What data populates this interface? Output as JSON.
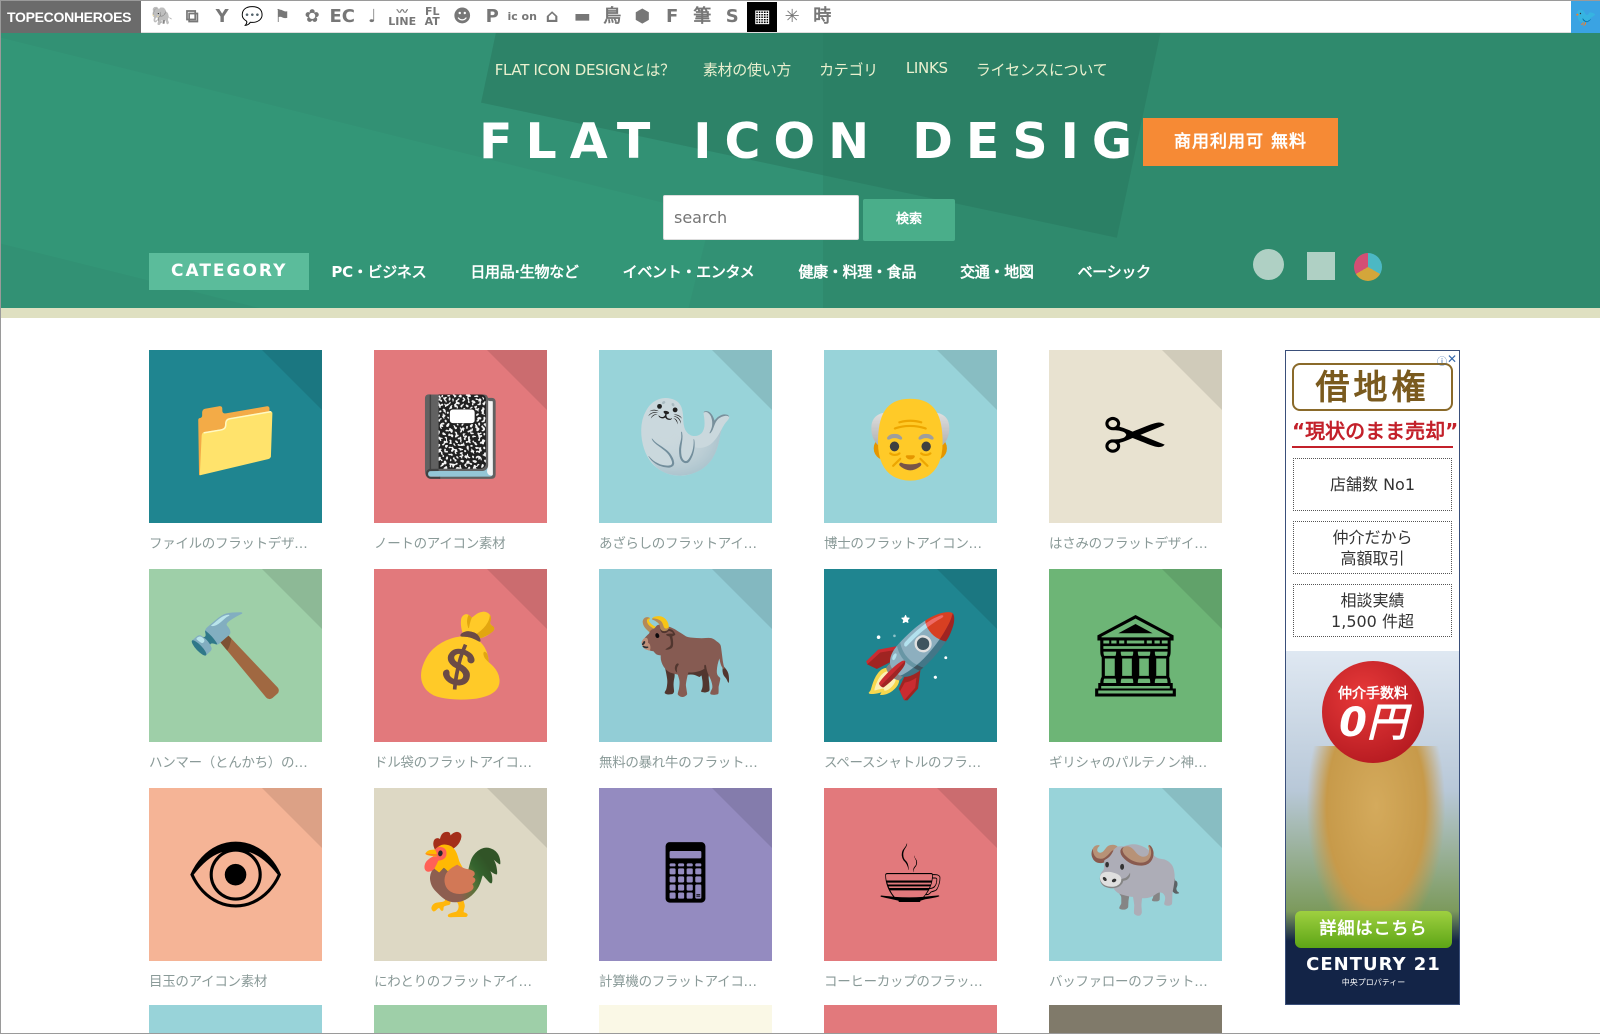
{
  "topbar": {
    "brand": "TOPECONHEROES",
    "site_icons": [
      {
        "name": "hippo-icon",
        "glyph": "🐘",
        "small": false
      },
      {
        "name": "window-icon",
        "glyph": "⧉",
        "small": false
      },
      {
        "name": "person-icon",
        "glyph": "Y",
        "small": false
      },
      {
        "name": "speech-bubble-icon",
        "glyph": "💬",
        "small": false
      },
      {
        "name": "flag-icon",
        "glyph": "⚑",
        "small": false
      },
      {
        "name": "flower-icon",
        "glyph": "✿",
        "small": false
      },
      {
        "name": "ec-icon",
        "glyph": "EC",
        "small": false
      },
      {
        "name": "music-note-icon",
        "glyph": "♩",
        "small": false
      },
      {
        "name": "line-icon",
        "glyph": "〰 LINE",
        "small": true
      },
      {
        "name": "flat-icon",
        "glyph": "FL AT",
        "small": true
      },
      {
        "name": "smiley-icon",
        "glyph": "☻",
        "small": false
      },
      {
        "name": "parking-icon",
        "glyph": "P",
        "small": false
      },
      {
        "name": "icon-on-icon",
        "glyph": "ic on",
        "small": true
      },
      {
        "name": "house-icon",
        "glyph": "⌂",
        "small": false
      },
      {
        "name": "bench-icon",
        "glyph": "▬",
        "small": false
      },
      {
        "name": "bird-kanji-icon",
        "glyph": "鳥",
        "small": false
      },
      {
        "name": "hexagon-icon",
        "glyph": "⬢",
        "small": false
      },
      {
        "name": "f-brush-icon",
        "glyph": "F",
        "small": false
      },
      {
        "name": "brush-kanji-icon",
        "glyph": "筆",
        "small": false
      },
      {
        "name": "s-icon",
        "glyph": "S",
        "small": false
      },
      {
        "name": "grid-icon",
        "glyph": "▦",
        "small": false
      },
      {
        "name": "burst-icon",
        "glyph": "✳",
        "small": false
      },
      {
        "name": "time-kanji-icon",
        "glyph": "時",
        "small": false
      }
    ],
    "twitter_icon": "🐦"
  },
  "header": {
    "nav": [
      "FLAT ICON DESIGNとは？",
      "素材の使い方",
      "カテゴリ",
      "LINKS",
      "ライセンスについて"
    ],
    "logo": "FLAT ICON DESIGN",
    "badge": "商用利用可 無料",
    "search": {
      "placeholder": "search",
      "value": "",
      "button": "検索"
    },
    "category_label": "CATEGORY",
    "categories": [
      "PC・ビジネス",
      "日用品·生物など",
      "イベント・エンタメ",
      "健康・料理・食品",
      "交通・地図",
      "ベーシック"
    ],
    "shape_filters": [
      "circle",
      "square",
      "color"
    ]
  },
  "colors": {
    "header_green": "#2f8a6d",
    "accent_orange": "#f68a35",
    "category_active": "#5bbc9b",
    "strip": "#dfe0c1"
  },
  "icons": [
    {
      "caption": "ファイルのフラットデザ…",
      "bg": "#1f8590",
      "glyph": "📁",
      "icon": "file-folder-icon"
    },
    {
      "caption": "ノートのアイコン素材",
      "bg": "#e2797c",
      "glyph": "📓",
      "icon": "notebook-icon"
    },
    {
      "caption": "あざらしのフラットアイ…",
      "bg": "#98d3d9",
      "glyph": "🦭",
      "icon": "seal-icon"
    },
    {
      "caption": "博士のフラットアイコン…",
      "bg": "#98d3d9",
      "glyph": "👴",
      "icon": "professor-icon"
    },
    {
      "caption": "はさみのフラットデザイ…",
      "bg": "#e8e2d0",
      "glyph": "✂",
      "icon": "scissors-icon"
    },
    {
      "caption": "ハンマー（とんかち）の…",
      "bg": "#9ecfa8",
      "glyph": "🔨",
      "icon": "hammer-icon"
    },
    {
      "caption": "ドル袋のフラットアイコ…",
      "bg": "#e2797c",
      "glyph": "💰",
      "icon": "money-bag-icon"
    },
    {
      "caption": "無料の暴れ牛のフラット…",
      "bg": "#92cdd6",
      "glyph": "🐂",
      "icon": "bull-icon"
    },
    {
      "caption": "スペースシャトルのフラ…",
      "bg": "#1f8590",
      "glyph": "🚀",
      "icon": "space-shuttle-icon"
    },
    {
      "caption": "ギリシャのパルテノン神…",
      "bg": "#6db576",
      "glyph": "🏛",
      "icon": "parthenon-icon"
    },
    {
      "caption": "目玉のアイコン素材",
      "bg": "#f5b496",
      "glyph": "👁",
      "icon": "eyeball-icon"
    },
    {
      "caption": "にわとりのフラットアイ…",
      "bg": "#ddd8c4",
      "glyph": "🐓",
      "icon": "chicken-icon"
    },
    {
      "caption": "計算機のフラットアイコ…",
      "bg": "#948bc0",
      "glyph": "🖩",
      "icon": "calculator-icon"
    },
    {
      "caption": "コーヒーカップのフラッ…",
      "bg": "#e2797c",
      "glyph": "☕",
      "icon": "coffee-cup-icon"
    },
    {
      "caption": "バッファローのフラット…",
      "bg": "#98d3d9",
      "glyph": "🐃",
      "icon": "buffalo-icon"
    }
  ],
  "partial_row": [
    {
      "bg": "#98d3d9"
    },
    {
      "bg": "#9ecfa8"
    },
    {
      "bg": "#faf8e6"
    },
    {
      "bg": "#e2797c"
    },
    {
      "bg": "#807a6a"
    }
  ],
  "ad": {
    "title": "借地権",
    "subtitle": "“現状のまま売却”",
    "boxes": [
      "店舗数 No1",
      "仲介だから\n高額取引",
      "相談実績\n1,500 件超"
    ],
    "circle_line1": "仲介手数料",
    "circle_line2": "0円",
    "button": "詳細はこちら",
    "brand": "CENTURY 21",
    "brand_sub": "中央プロパティー",
    "info_icon": "ⓘ",
    "close_icon": "✕"
  }
}
